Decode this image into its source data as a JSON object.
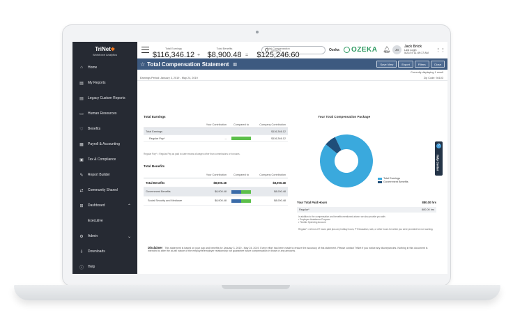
{
  "brand": {
    "name": "TriNet",
    "subtitle": "Workforce Analytics"
  },
  "sidebar": {
    "items": [
      {
        "label": "Home",
        "icon": "home-icon"
      },
      {
        "label": "My Reports",
        "icon": "report-icon"
      },
      {
        "label": "Legacy Custom Reports",
        "icon": "report-icon"
      },
      {
        "label": "Human Resources",
        "icon": "folder-icon"
      },
      {
        "label": "Benefits",
        "icon": "heart-icon"
      },
      {
        "label": "Payroll & Accounting",
        "icon": "payroll-icon"
      },
      {
        "label": "Tax & Compliance",
        "icon": "tax-icon"
      },
      {
        "label": "Report Builder",
        "icon": "builder-icon"
      },
      {
        "label": "Community Shared",
        "icon": "share-icon"
      },
      {
        "label": "Dashboard",
        "icon": "dashboard-icon"
      },
      {
        "label": "Executive",
        "icon": ""
      },
      {
        "label": "Admin",
        "icon": "admin-icon"
      },
      {
        "label": "Downloads",
        "icon": "download-icon"
      },
      {
        "label": "Help",
        "icon": "help-icon"
      }
    ]
  },
  "topbar": {
    "search_placeholder": "Search...",
    "company_label": "Ozeka",
    "company_logo": "OZEKA",
    "avatar_initials": "JB",
    "user_name": "Jack Brick",
    "user_line2": "Last Login",
    "user_line3": "5/22/19 11:49:17 AM"
  },
  "titlebar": {
    "title": "Total Compensation Statement",
    "buttons": [
      "Save View",
      "Export",
      "Filters",
      "Close"
    ]
  },
  "subbar": {
    "displaying": "Currently displaying 1 result",
    "period": "Earnings Period: January 3, 2019 - May 24, 2019",
    "zip": "Zip Code: 94103"
  },
  "totals": {
    "earnings_label": "Total Earnings",
    "earnings_value": "$116,346.12",
    "benefits_label": "Total Benefits",
    "benefits_value": "$8,900.48",
    "comp_label": "Total Compensation",
    "comp_value": "$125,246.60",
    "plus": "+",
    "equals": "="
  },
  "earnings": {
    "title": "Total Earnings",
    "headers": [
      "",
      "Your Contribution",
      "Compared to",
      "Company Contribution"
    ],
    "rows": [
      {
        "label": "Total Earnings",
        "yours": "",
        "company": "$116,346.12"
      },
      {
        "label": "Regular Pay*",
        "yours": "--",
        "company": "$116,346.12",
        "bar_fraction": 1.0
      }
    ]
  },
  "footnote": "Regular Pay* = Regular Pay as paid to date means all wages other than commissions or bonuses.",
  "benefits": {
    "title": "Total Benefits",
    "headers": [
      "",
      "Your Contribution",
      "Compared to",
      "Company Contribution"
    ],
    "rows": [
      {
        "label": "Total Benefits",
        "yours": "$8,900.48",
        "company": "$8,900.48"
      },
      {
        "label": "Government Benefits",
        "yours": "$8,900.48",
        "company": "$8,900.48",
        "blue_fraction": 0.5,
        "green_fraction": 0.5
      },
      {
        "label": "Social Security and Medicare",
        "yours": "$8,900.48",
        "company": "$8,900.48",
        "blue_fraction": 0.5,
        "green_fraction": 0.5
      }
    ]
  },
  "chart_data": {
    "type": "pie",
    "title": "Your Total Compensation Package",
    "categories": [
      "Total Earnings",
      "Government Benefits"
    ],
    "values": [
      116346.12,
      8900.48
    ],
    "colors": [
      "#3aa9dd",
      "#1f4e79"
    ],
    "donut": true,
    "legend": "bottom-right"
  },
  "paid_hours": {
    "title": "Your Total Paid Hours",
    "title_value": "880.00 hrs",
    "row_label": "Regular*",
    "row_value": "880.00 hrs"
  },
  "notes": {
    "intro": "In addition to the compensation and benefits mentioned above, we also provide you with:",
    "item1": "• Employee Assistance Program",
    "item2": "• Flexible Spending Account",
    "regular": "Regular* = All non-OT hours paid plus any holiday hours, PTO/vacation, sick, or other hours for which you were provided for non working."
  },
  "disclaimer": {
    "label": "Disclaimer",
    "text": "This statement is based on your pay and benefits for January 3, 2019 - May 24, 2019. Every effort has been made to ensure the accuracy of this statement. Please contact TriNet if you notice any discrepancies. Nothing in this document is intended to alter the at-will nature of the employee/employer relationship nor guarantee future compensation in those or any amounts."
  },
  "help_tab": {
    "label": "Help Center",
    "glyph": "?"
  }
}
